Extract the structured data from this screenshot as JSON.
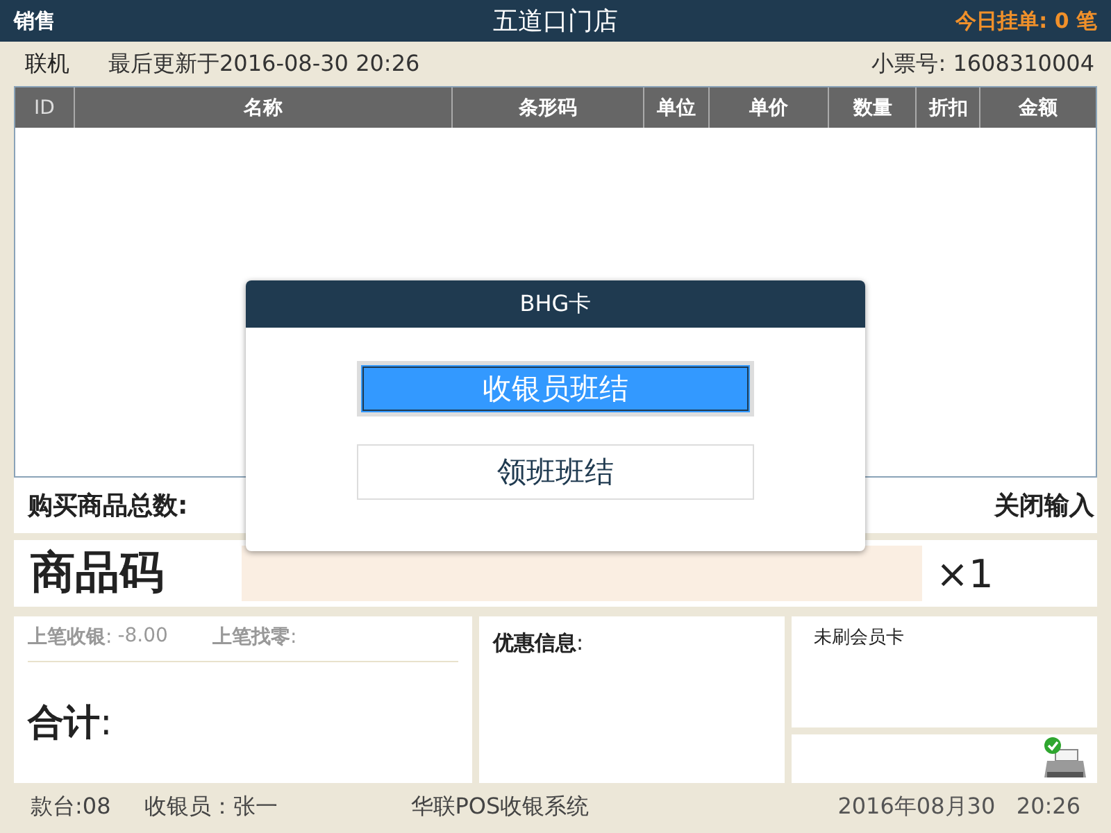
{
  "header": {
    "mode": "销售",
    "store": "五道口门店",
    "pending_label": "今日挂单:",
    "pending_count": "0",
    "pending_unit": "笔"
  },
  "info": {
    "connection": "联机",
    "last_update": "最后更新于2016-08-30 20:26",
    "receipt_label": "小票号:",
    "receipt_no": "1608310004"
  },
  "table": {
    "columns": [
      "ID",
      "名称",
      "条形码",
      "单位",
      "单价",
      "数量",
      "折扣",
      "金额"
    ]
  },
  "summary": {
    "total_items_label": "购买商品总数:",
    "close_input": "关闭输入"
  },
  "product_code": {
    "label": "商品码",
    "quantity": "×1"
  },
  "last": {
    "paid_label": "**上笔收银**:",
    "paid_value": "-8.00",
    "change_label": "**上笔找零**:"
  },
  "total_label": "**合计**:",
  "discount_label": "**优惠信息**:",
  "member": "未刷会员卡",
  "footer": {
    "counter_label": "款台:",
    "counter": "08",
    "cashier_label": "收银员：",
    "cashier": "张一",
    "system": "华联POS收银系统",
    "date": "2016年08月30",
    "time": "20:26"
  },
  "dialog": {
    "title": "BHG卡",
    "options": [
      {
        "label": "收银员班结",
        "selected": true
      },
      {
        "label": "领班班结",
        "selected": false
      }
    ]
  }
}
